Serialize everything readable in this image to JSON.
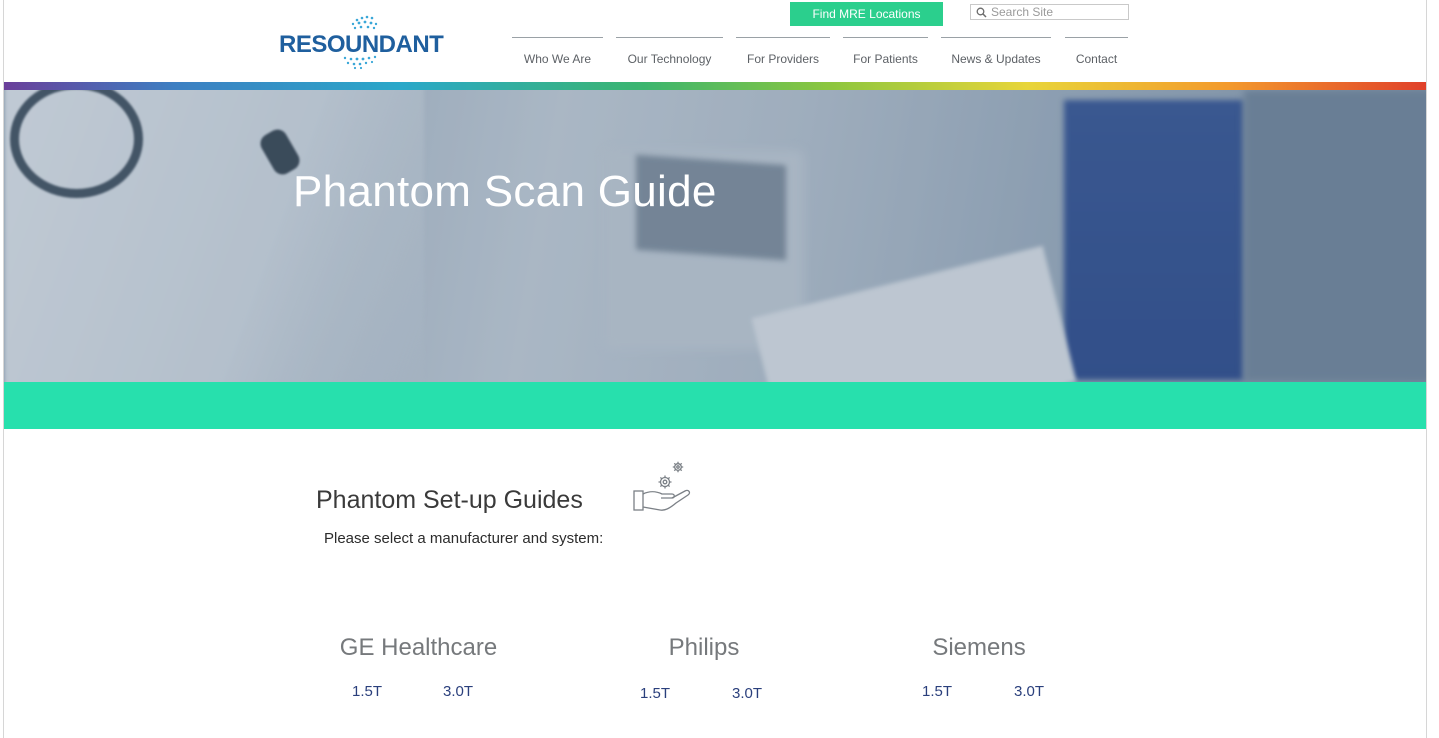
{
  "header": {
    "logo_text": "RESOUNDANT",
    "cta_label": "Find MRE Locations",
    "search_placeholder": "Search Site",
    "nav": [
      {
        "label": "Who We Are"
      },
      {
        "label": "Our Technology"
      },
      {
        "label": "For Providers"
      },
      {
        "label": "For Patients"
      },
      {
        "label": "News & Updates"
      },
      {
        "label": "Contact"
      }
    ]
  },
  "hero": {
    "title": "Phantom Scan Guide"
  },
  "content": {
    "section_title": "Phantom Set-up Guides",
    "subtitle": "Please select a manufacturer and system:",
    "icon": "hand-with-gears-icon",
    "manufacturers": [
      {
        "name": "GE Healthcare",
        "systems": [
          "1.5T",
          "3.0T"
        ]
      },
      {
        "name": "Philips",
        "systems": [
          "1.5T",
          "3.0T"
        ]
      },
      {
        "name": "Siemens",
        "systems": [
          "1.5T",
          "3.0T"
        ]
      }
    ]
  },
  "colors": {
    "cta": "#2bcf8d",
    "band": "#27e0ad",
    "logo": "#1f5f9e",
    "link": "#2a3f7c"
  }
}
